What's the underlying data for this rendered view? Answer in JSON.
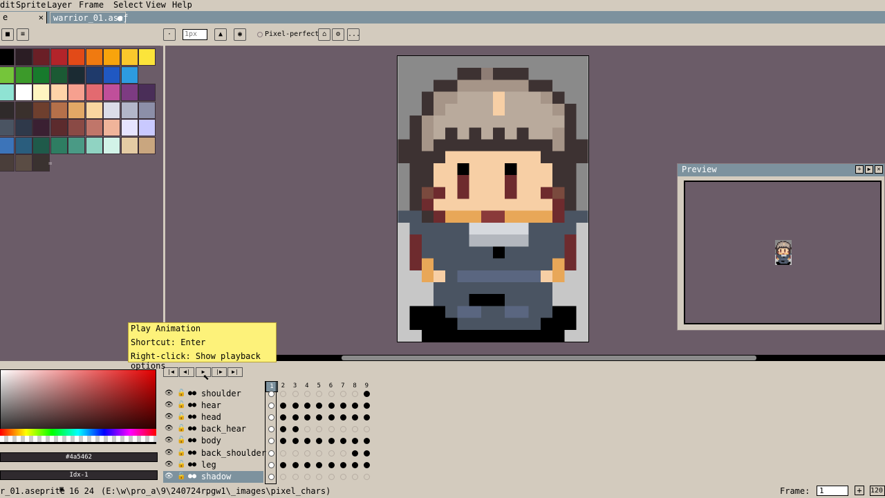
{
  "menu": [
    "dit",
    "Sprite",
    "Layer",
    "Frame",
    "Select",
    "View",
    "Help"
  ],
  "tabs": [
    {
      "label": "e"
    },
    {
      "label": "warrior_01.aseƒ"
    }
  ],
  "toolbar": {
    "size_value": "1px",
    "pixel_perfect_label": "Pixel-perfect",
    "more": "..."
  },
  "palette_marker": "=",
  "preview": {
    "title": "Preview"
  },
  "tooltip": {
    "line1": "Play Animation",
    "line2": "Shortcut: Enter",
    "line3": "Right-click: Show playback options"
  },
  "color": {
    "hex": "#4a5462",
    "index": "Idx-1"
  },
  "layers": [
    {
      "name": "shoulder"
    },
    {
      "name": "hear"
    },
    {
      "name": "head"
    },
    {
      "name": "back_hear"
    },
    {
      "name": "body"
    },
    {
      "name": "back_shoulder"
    },
    {
      "name": "leg"
    },
    {
      "name": "shadow"
    }
  ],
  "frames": [
    "1",
    "2",
    "3",
    "4",
    "5",
    "6",
    "7",
    "8",
    "9"
  ],
  "status": {
    "filename": "r_01.aseprite",
    "size": "16 24",
    "path": "(E:\\w\\pro_a\\9\\240724rpgw1\\_images\\pixel_chars)",
    "frame_label": "Frame:",
    "frame_value": "1",
    "zoom": "120"
  },
  "colors": {
    "accent": "#7d929e",
    "chrome": "#d3cbbe",
    "workspace": "#6b5c68",
    "tooltip": "#fdf27a"
  }
}
